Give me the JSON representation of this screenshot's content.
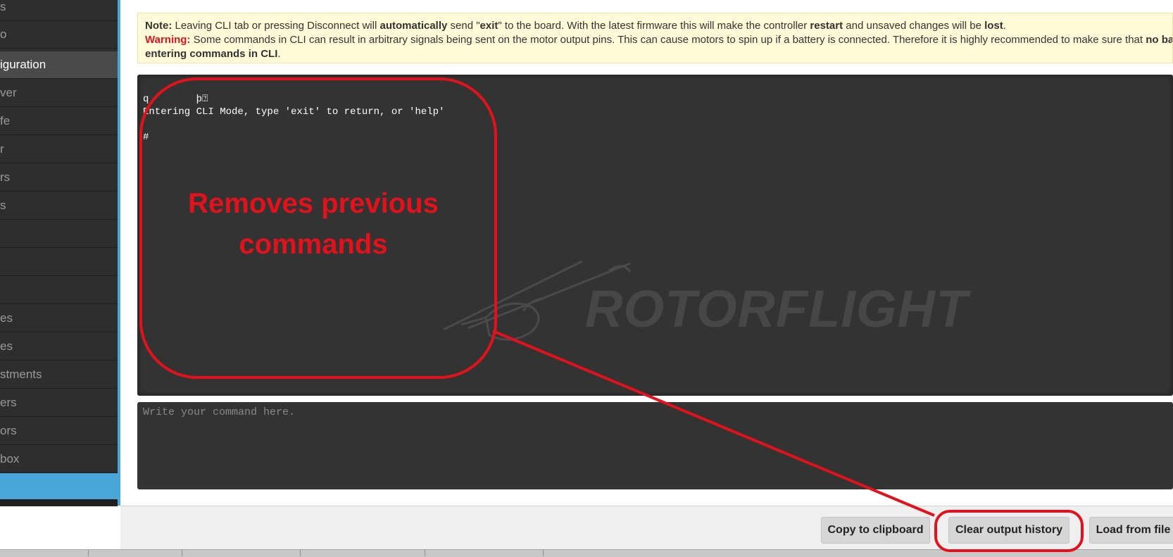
{
  "sidebar": {
    "items": [
      {
        "label": "s"
      },
      {
        "label": "o"
      },
      {
        "label": "iguration",
        "active": true
      },
      {
        "label": "ver"
      },
      {
        "label": "fe"
      },
      {
        "label": "r"
      },
      {
        "label": "rs"
      },
      {
        "label": "s"
      },
      {
        "label": ""
      },
      {
        "label": ""
      },
      {
        "label": ""
      },
      {
        "label": "es"
      },
      {
        "label": "es"
      },
      {
        "label": "stments"
      },
      {
        "label": "ers"
      },
      {
        "label": "ors"
      },
      {
        "label": "box"
      }
    ]
  },
  "notice": {
    "note_label": "Note:",
    "note_text_1": " Leaving CLI tab or pressing Disconnect will ",
    "note_bold_1": "automatically",
    "note_text_2": " send \"",
    "note_bold_2": "exit",
    "note_text_3": "\" to the board. With the latest firmware this will make the controller ",
    "note_bold_3": "restart",
    "note_text_4": " and unsaved changes will be ",
    "note_bold_4": "lost",
    "note_text_5": ".",
    "warning_label": "Warning:",
    "warning_text_1": " Some commands in CLI can result in arbitrary signals being sent on the motor output pins. This can cause motors to spin up if a battery is connected. Therefore it is highly recommended to make sure that ",
    "warning_bold_1": "no battery is",
    "warning_bold_2": "entering commands in CLI",
    "warning_text_2": "."
  },
  "cli": {
    "lines": [
      "q        þ⍰",
      "Entering CLI Mode, type 'exit' to return, or 'help'",
      "",
      "#"
    ],
    "watermark": "ROTORFLIGHT",
    "input_placeholder": "Write your command here."
  },
  "buttons": {
    "copy": "Copy to clipboard",
    "clear": "Clear output history",
    "load": "Load from file"
  },
  "annotation": {
    "line1": "Removes previous",
    "line2": "commands",
    "color": "#e2121d"
  },
  "colors": {
    "accent": "#49a6db",
    "cli_bg": "#333333",
    "notice_bg": "#fffbd9",
    "warning_red": "#e2121d"
  }
}
